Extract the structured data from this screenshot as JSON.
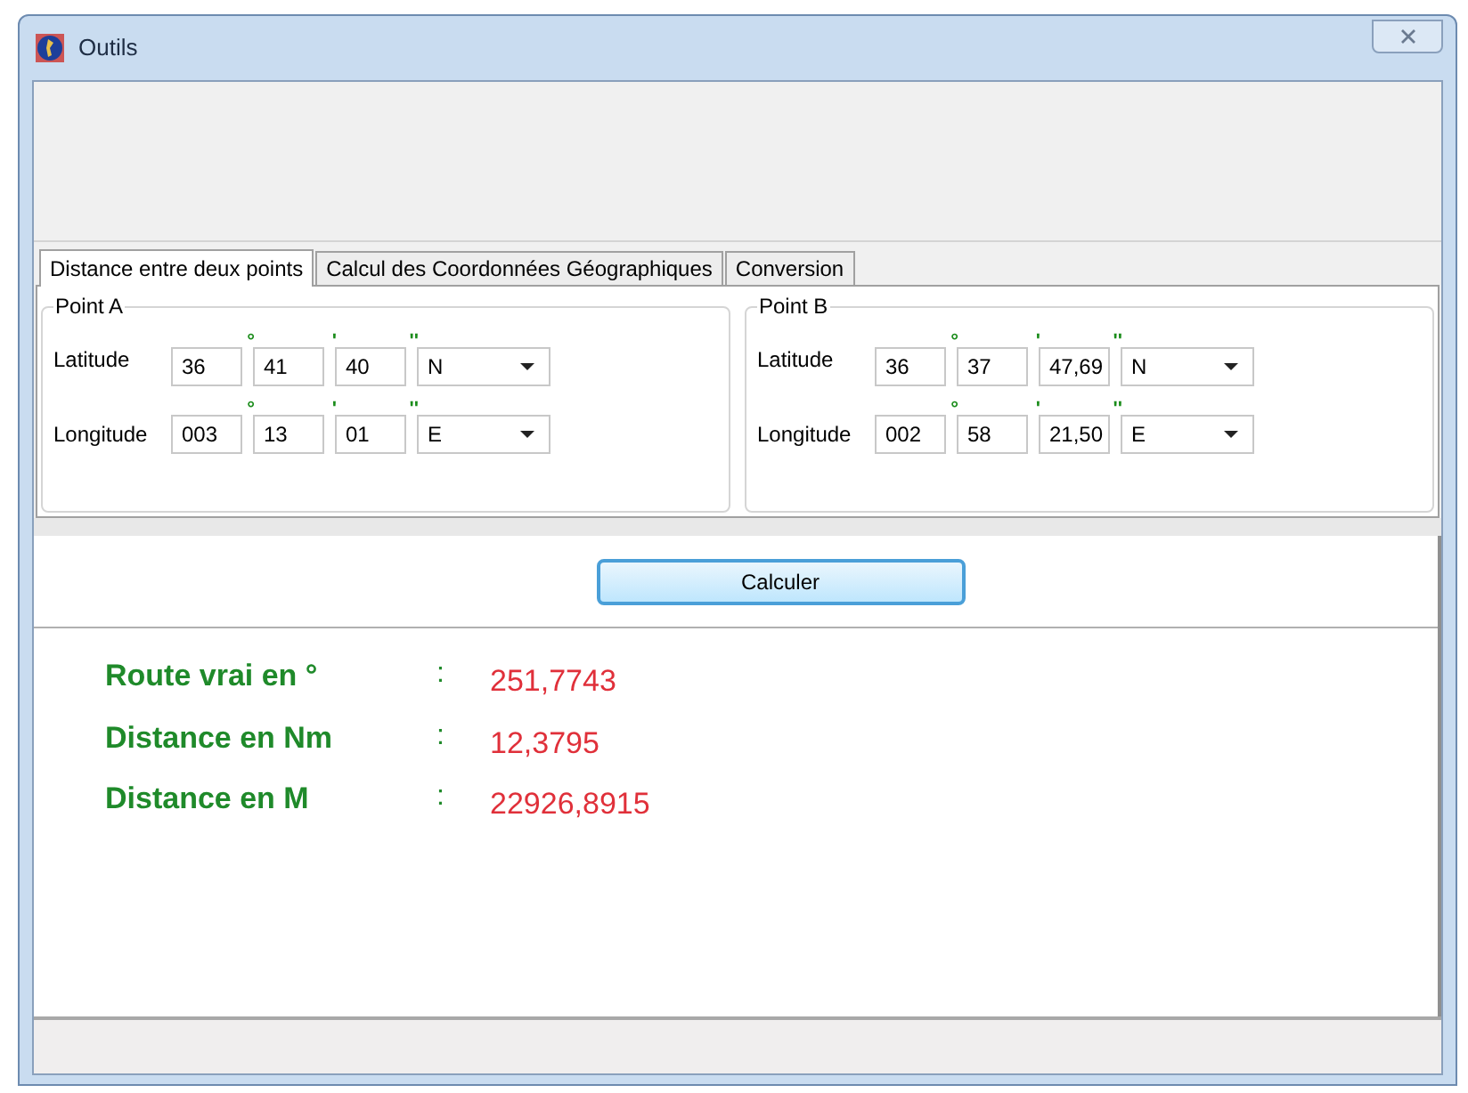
{
  "window": {
    "title": "Outils"
  },
  "tabs": [
    {
      "label": "Distance entre deux points",
      "selected": true
    },
    {
      "label": "Calcul des Coordonnées Géographiques",
      "selected": false
    },
    {
      "label": "Conversion",
      "selected": false
    }
  ],
  "unit_marks": [
    "°",
    "'",
    "''"
  ],
  "points": [
    {
      "title": "Point A",
      "rows": [
        {
          "label": "Latitude",
          "degrees": "36",
          "minutes": "41",
          "seconds": "40",
          "hemisphere": "N"
        },
        {
          "label": "Longitude",
          "degrees": "003",
          "minutes": "13",
          "seconds": "01",
          "hemisphere": "E"
        }
      ]
    },
    {
      "title": "Point B",
      "rows": [
        {
          "label": "Latitude",
          "degrees": "36",
          "minutes": "37",
          "seconds": "47,69",
          "hemisphere": "N"
        },
        {
          "label": "Longitude",
          "degrees": "002",
          "minutes": "58",
          "seconds": "21,50",
          "hemisphere": "E"
        }
      ]
    }
  ],
  "button": "Calculer",
  "results": [
    {
      "label": "Route vrai en °",
      "separator": ":",
      "value": "251,7743"
    },
    {
      "label": "Distance en Nm",
      "separator": ":",
      "value": "12,3795"
    },
    {
      "label": "Distance en M",
      "separator": ":",
      "value": "22926,8915"
    }
  ]
}
